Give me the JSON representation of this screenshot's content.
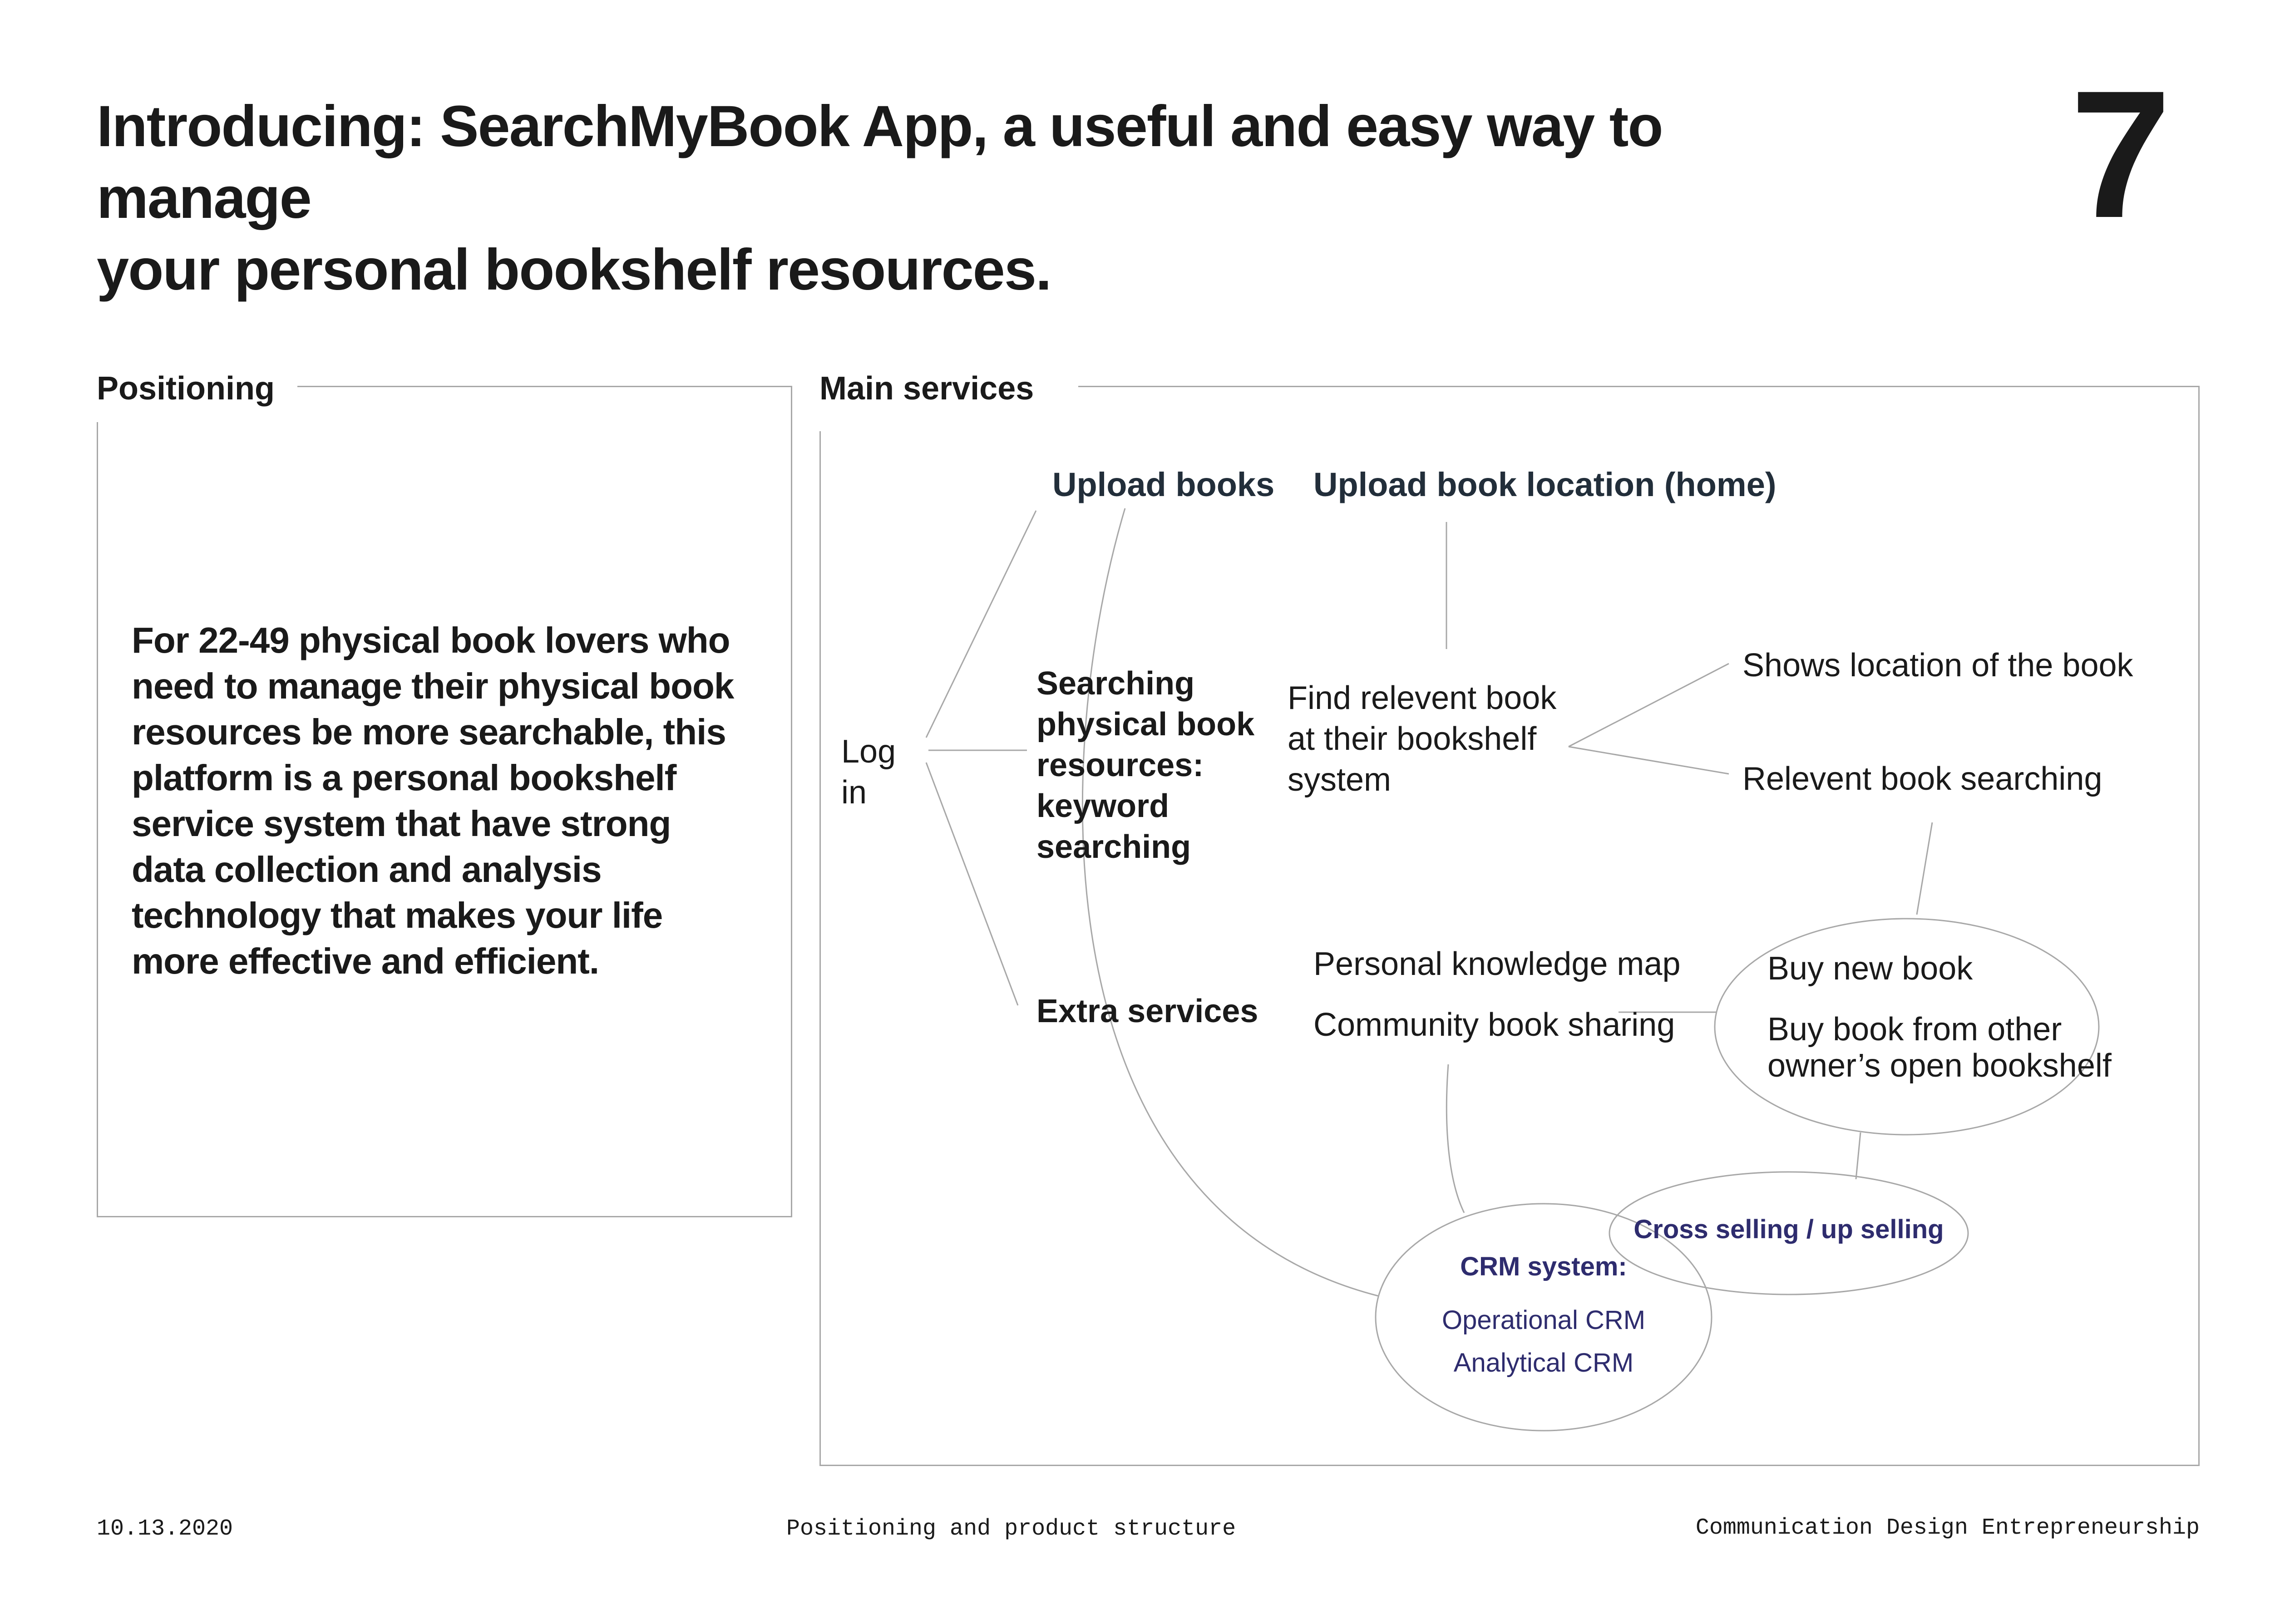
{
  "header": {
    "title_lines": [
      "Introducing: SearchMyBook App, a useful and easy way to manage",
      "your personal bookshelf resources."
    ],
    "page_number": "7"
  },
  "positioning": {
    "label": "Positioning",
    "text_lines": [
      "For 22-49 physical book lovers who",
      "need to manage their physical book",
      "resources be more searchable, this",
      "platform is a personal bookshelf",
      "service system that have strong",
      "data collection and analysis",
      "technology that makes your life",
      "more effective and efficient."
    ]
  },
  "main_services": {
    "label": "Main services",
    "login_lines": [
      "Log",
      "in"
    ],
    "upload_books": "Upload books",
    "upload_location": "Upload book location (home)",
    "searching_lines": [
      "Searching",
      "physical book",
      "resources:",
      "keyword",
      "searching"
    ],
    "find_lines": [
      "Find relevent book",
      "at their bookshelf",
      "system"
    ],
    "shows_location": "Shows location of the book",
    "relevent_searching": "Relevent book searching",
    "extra_services": "Extra services",
    "knowledge_map": "Personal knowledge map",
    "community_sharing": "Community book sharing",
    "buy_new": "Buy new book",
    "buy_other_lines": [
      "Buy book from other",
      "owner’s open bookshelf"
    ],
    "cross_selling": "Cross selling / up selling",
    "crm_title": "CRM system:",
    "crm_operational": "Operational CRM",
    "crm_analytical": "Analytical CRM"
  },
  "footer": {
    "date": "10.13.2020",
    "center": "Positioning and product structure",
    "right": "Communication Design Entrepreneurship"
  },
  "colors": {
    "text": "#1a1a1a",
    "heading_dark": "#222e3a",
    "crm_purple": "#2e2c6e",
    "line_gray": "#a8a8a8"
  }
}
